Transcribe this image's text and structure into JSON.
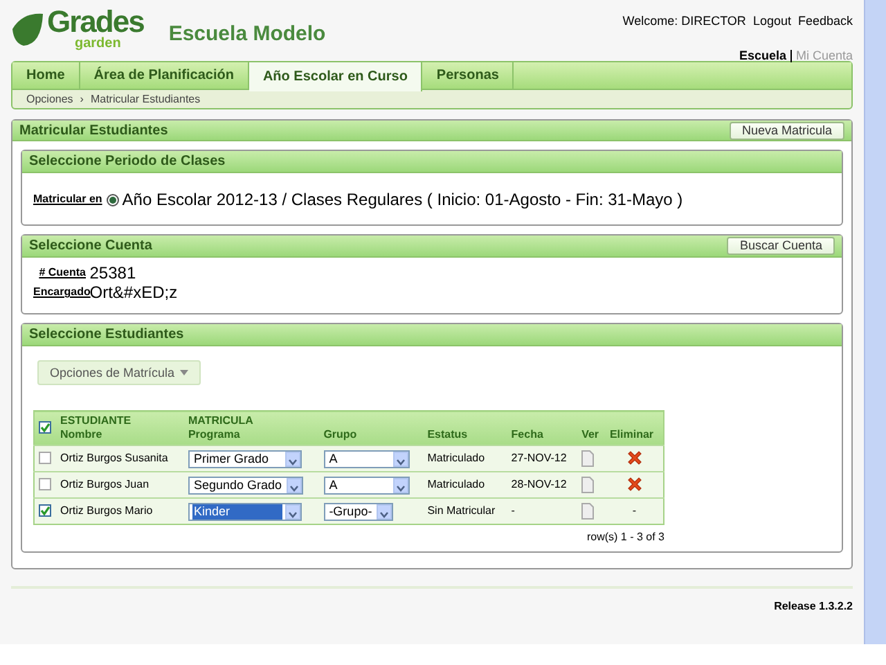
{
  "logo": {
    "big": "Grades",
    "small": "garden"
  },
  "school": "Escuela Modelo",
  "welcome": "Welcome: DIRECTOR",
  "top_links": [
    "Logout",
    "Feedback"
  ],
  "context_links": [
    {
      "label": "Escuela",
      "selected": true
    },
    {
      "label": "Mi Cuenta",
      "selected": false
    }
  ],
  "tabs": [
    {
      "label": "Home",
      "selected": false
    },
    {
      "label": "Área de Planificación",
      "selected": false
    },
    {
      "label": "Año Escolar en Curso",
      "selected": true
    },
    {
      "label": "Personas",
      "selected": false
    }
  ],
  "breadcrumb": {
    "separator": "›",
    "items": [
      "Opciones",
      "Matricular Estudiantes"
    ]
  },
  "main_panel": {
    "title": "Matricular Estudiantes",
    "button": "Nueva Matricula"
  },
  "period_panel": {
    "title": "Seleccione Periodo de Clases",
    "label": "Matricular en",
    "option": {
      "label": "Año Escolar 2012-13 / Clases Regulares ( Inicio: 01-Agosto - Fin: 31-Mayo )",
      "selected": true
    }
  },
  "account_panel": {
    "title": "Seleccione Cuenta",
    "button": "Buscar Cuenta",
    "fields": [
      {
        "label": "# Cuenta",
        "value": "25381"
      },
      {
        "label": "Encargado",
        "value": "Ort&#xED;z"
      }
    ]
  },
  "students_panel": {
    "title": "Seleccione Estudiantes",
    "options_button": "Opciones de Matrícula",
    "header_checked": true,
    "columns": [
      {
        "top": "ESTUDIANTE",
        "label": "Nombre"
      },
      {
        "top": "MATRICULA",
        "label": "Programa"
      },
      {
        "label": "Grupo"
      },
      {
        "label": "Estatus"
      },
      {
        "label": "Fecha"
      },
      {
        "label": "Ver"
      },
      {
        "label": "Eliminar"
      }
    ],
    "rows": [
      {
        "checked": false,
        "name": "Ortiz Burgos Susanita",
        "program": {
          "value": "Primer Grado",
          "focused": false
        },
        "group": {
          "value": "A",
          "wide": true
        },
        "status": "Matriculado",
        "date": "27-NOV-12",
        "delete": {
          "kind": "icon"
        }
      },
      {
        "checked": false,
        "name": "Ortiz Burgos Juan",
        "program": {
          "value": "Segundo Grado",
          "focused": false
        },
        "group": {
          "value": "A",
          "wide": true
        },
        "status": "Matriculado",
        "date": "28-NOV-12",
        "delete": {
          "kind": "icon"
        }
      },
      {
        "checked": true,
        "name": "Ortiz Burgos Mario",
        "program": {
          "value": "Kinder",
          "focused": true
        },
        "group": {
          "value": "-Grupo-",
          "wide": false
        },
        "status": "Sin Matricular",
        "date": "-",
        "delete": {
          "kind": "text",
          "text": "-"
        }
      }
    ],
    "pagination": "row(s) 1 - 3 of 3"
  },
  "footer": {
    "release": "Release 1.3.2.2"
  }
}
